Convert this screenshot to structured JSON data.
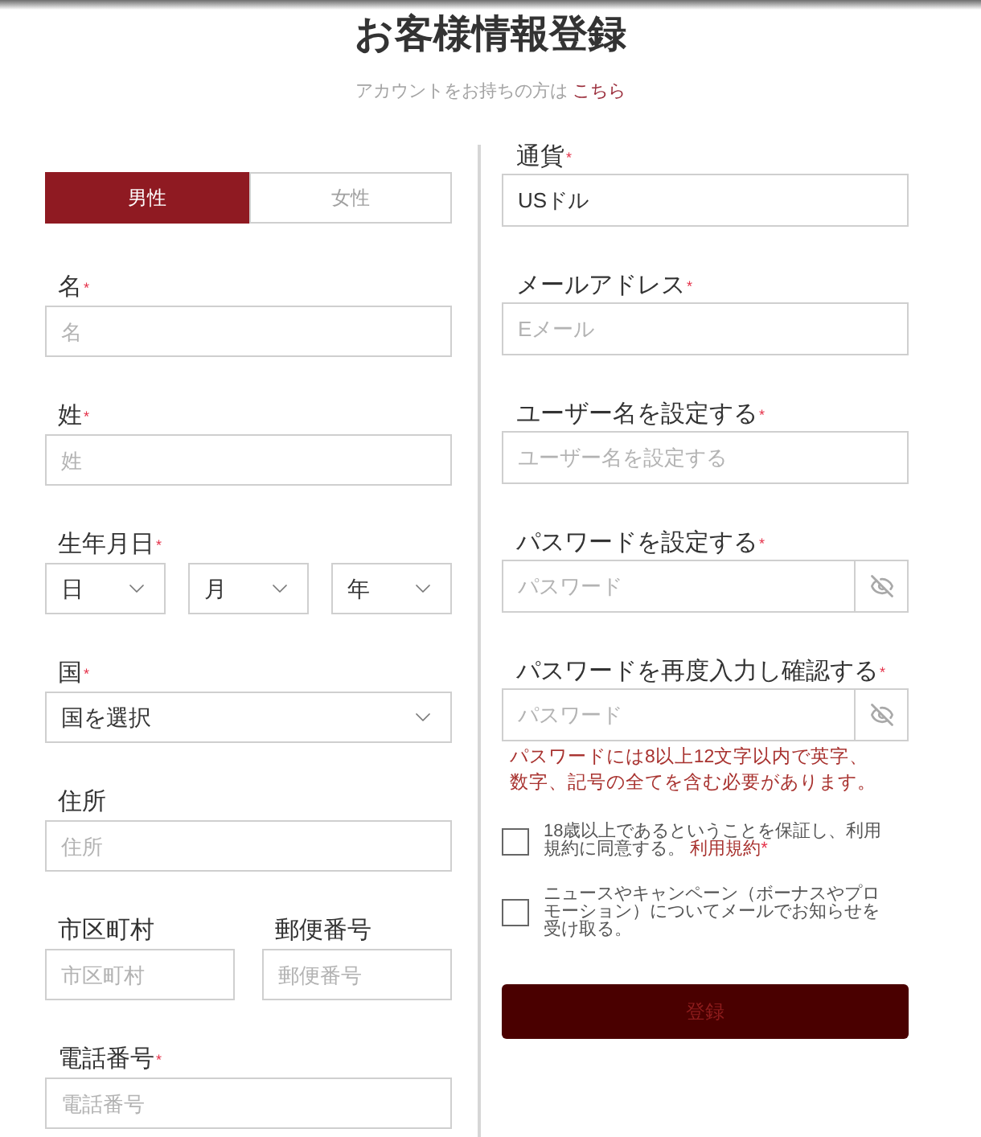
{
  "title": "お客様情報登録",
  "login_prompt": {
    "text": "アカウントをお持ちの方は",
    "link": "こちら"
  },
  "gender": [
    {
      "label": "男性",
      "selected": true
    },
    {
      "label": "女性",
      "selected": false
    }
  ],
  "left_fields": [
    {
      "kind": "input",
      "label": "名",
      "mark": "*",
      "placeholder": "名"
    },
    {
      "kind": "input",
      "label": "姓",
      "mark": "*",
      "placeholder": "姓"
    },
    {
      "kind": "dropdowns",
      "label": "生年月日",
      "mark": "*",
      "dropdowns": [
        {
          "value": "日"
        },
        {
          "value": "月"
        },
        {
          "value": "年"
        }
      ]
    },
    {
      "kind": "dropdown",
      "label": "国",
      "mark": "*",
      "value": "国を選択"
    },
    {
      "kind": "input",
      "label": "住所",
      "placeholder": "住所"
    },
    {
      "kind": "pair",
      "fields": [
        {
          "label": "市区町村",
          "placeholder": "市区町村"
        },
        {
          "label": "郵便番号",
          "placeholder": "郵便番号"
        }
      ]
    },
    {
      "kind": "input",
      "label": "電話番号",
      "mark": "*",
      "placeholder": "電話番号"
    }
  ],
  "right_fields": [
    {
      "kind": "input",
      "label": "通貨",
      "mark": "*",
      "value": "USドル"
    },
    {
      "kind": "input",
      "label": "メールアドレス",
      "mark": "*",
      "placeholder": "Eメール"
    },
    {
      "kind": "input",
      "label": "ユーザー名を設定する",
      "mark": "*",
      "placeholder": "ユーザー名を設定する"
    },
    {
      "kind": "password",
      "label": "パスワードを設定する",
      "mark": "*",
      "placeholder": "パスワード"
    },
    {
      "kind": "password",
      "label": "パスワードを再度入力し確認する",
      "mark": "*",
      "placeholder": "パスワード",
      "hint": "パスワードには8以上12文字以内で英字、数字、記号の全てを含む必要があります。"
    }
  ],
  "checkboxes": [
    {
      "text": "18歳以上であるということを保証し、利用規約に同意する。",
      "link": "利用規約",
      "mark": "*",
      "checked": false
    },
    {
      "text": "ニュースやキャンペーン（ボーナスやプロモーション）についてメールでお知らせを受け取る。",
      "checked": false
    }
  ],
  "register_button": {
    "label": "登録",
    "disabled": true
  }
}
